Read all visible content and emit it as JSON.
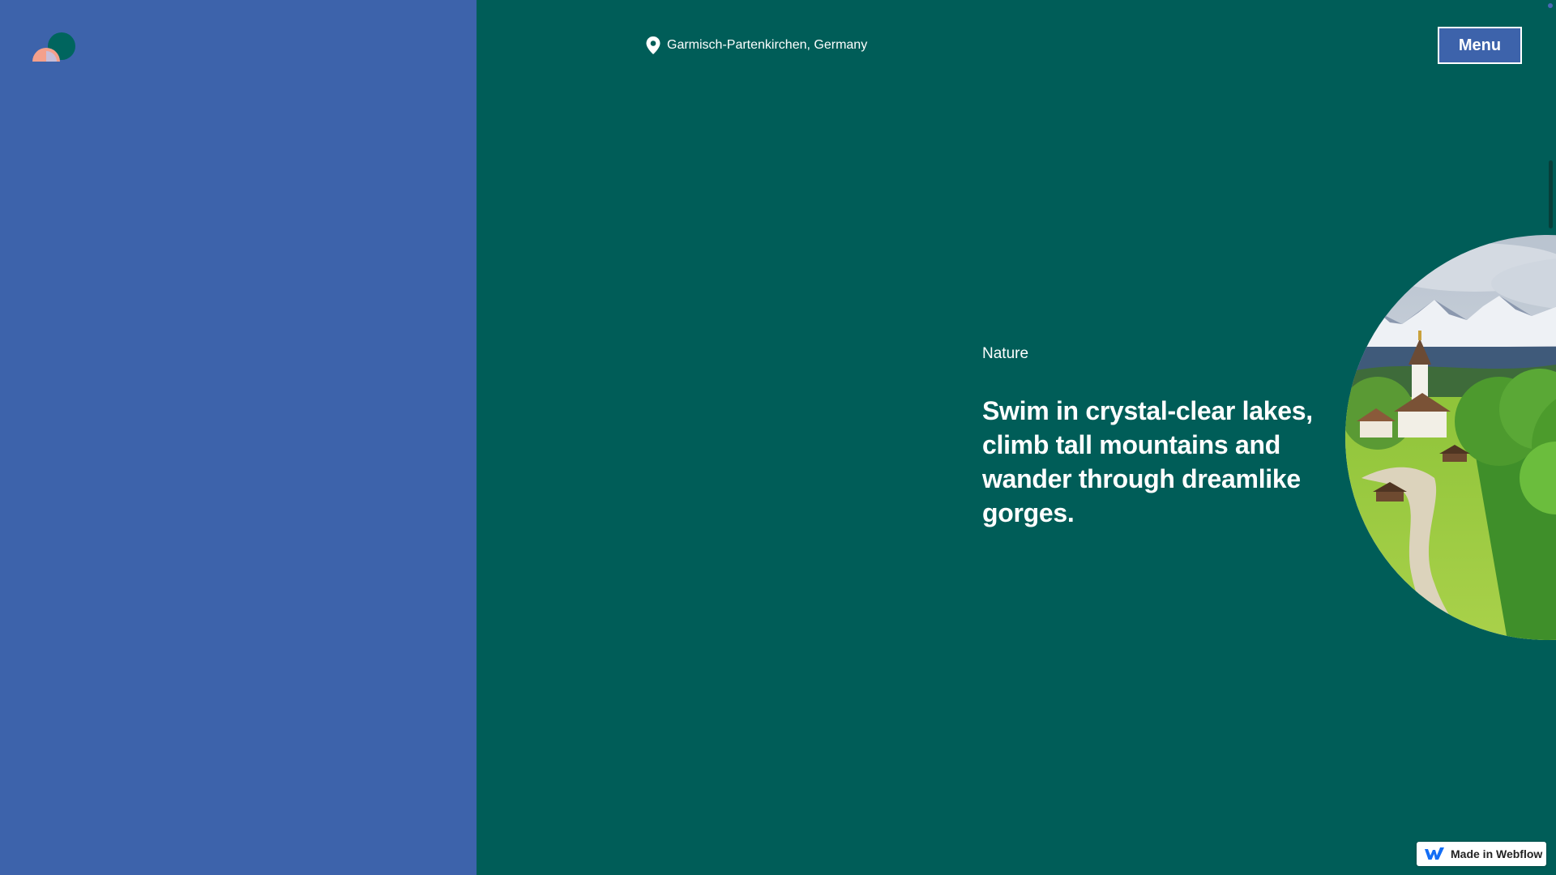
{
  "colors": {
    "left_panel": "#3d63ab",
    "right_panel": "#005d58",
    "menu_button_bg": "#3d63ab",
    "logo_green": "#00655e",
    "logo_peach": "#f4a08b",
    "logo_lilac": "#c7bdd8",
    "webflow_blue": "#146ef5"
  },
  "header": {
    "logo_icon": "sunrise-logo-icon",
    "location_icon": "map-pin-icon",
    "location_text": "Garmisch-Partenkirchen, Germany",
    "menu_label": "Menu"
  },
  "hero": {
    "category": "Nature",
    "headline": "Swim in crystal-clear lakes, climb tall mountains and wander through dreamlike gorges.",
    "image_icon": "alpine-village-photo"
  },
  "badge": {
    "icon": "webflow-logo-icon",
    "label": "Made in Webflow"
  }
}
